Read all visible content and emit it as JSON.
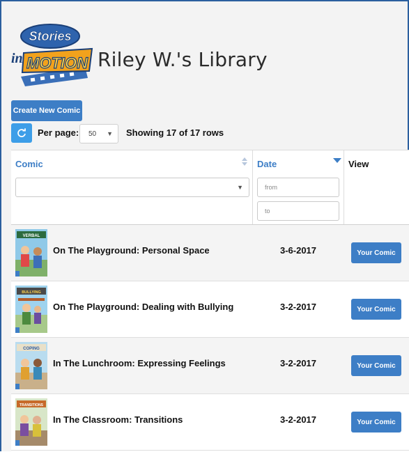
{
  "header": {
    "logo_line1": "Stories",
    "logo_line2": "in",
    "logo_line3": "MOTION",
    "title": "Riley W.'s Library"
  },
  "toolbar": {
    "create_label": "Create New Comic",
    "per_page_label": "Per page:",
    "per_page_value": "50",
    "showing_text": "Showing 17 of 17 rows"
  },
  "table": {
    "columns": {
      "comic": "Comic",
      "date": "Date",
      "view": "View"
    },
    "date_from_placeholder": "from",
    "date_to_placeholder": "to",
    "rows": [
      {
        "title": "On The Playground: Personal Space",
        "date": "3-6-2017",
        "button": "Your Comic",
        "thumb_caption": "VERBAL"
      },
      {
        "title": "On The Playground: Dealing with Bullying",
        "date": "3-2-2017",
        "button": "Your Comic",
        "thumb_caption": "BULLYING"
      },
      {
        "title": "In The Lunchroom: Expressing Feelings",
        "date": "3-2-2017",
        "button": "Your Comic",
        "thumb_caption": "COPING"
      },
      {
        "title": "In The Classroom: Transitions",
        "date": "3-2-2017",
        "button": "Your Comic",
        "thumb_caption": "TRANSITIONS"
      }
    ]
  },
  "colors": {
    "primary": "#3d7ec6",
    "refresh": "#3d9ee8",
    "frame_border": "#2a5f9e"
  }
}
